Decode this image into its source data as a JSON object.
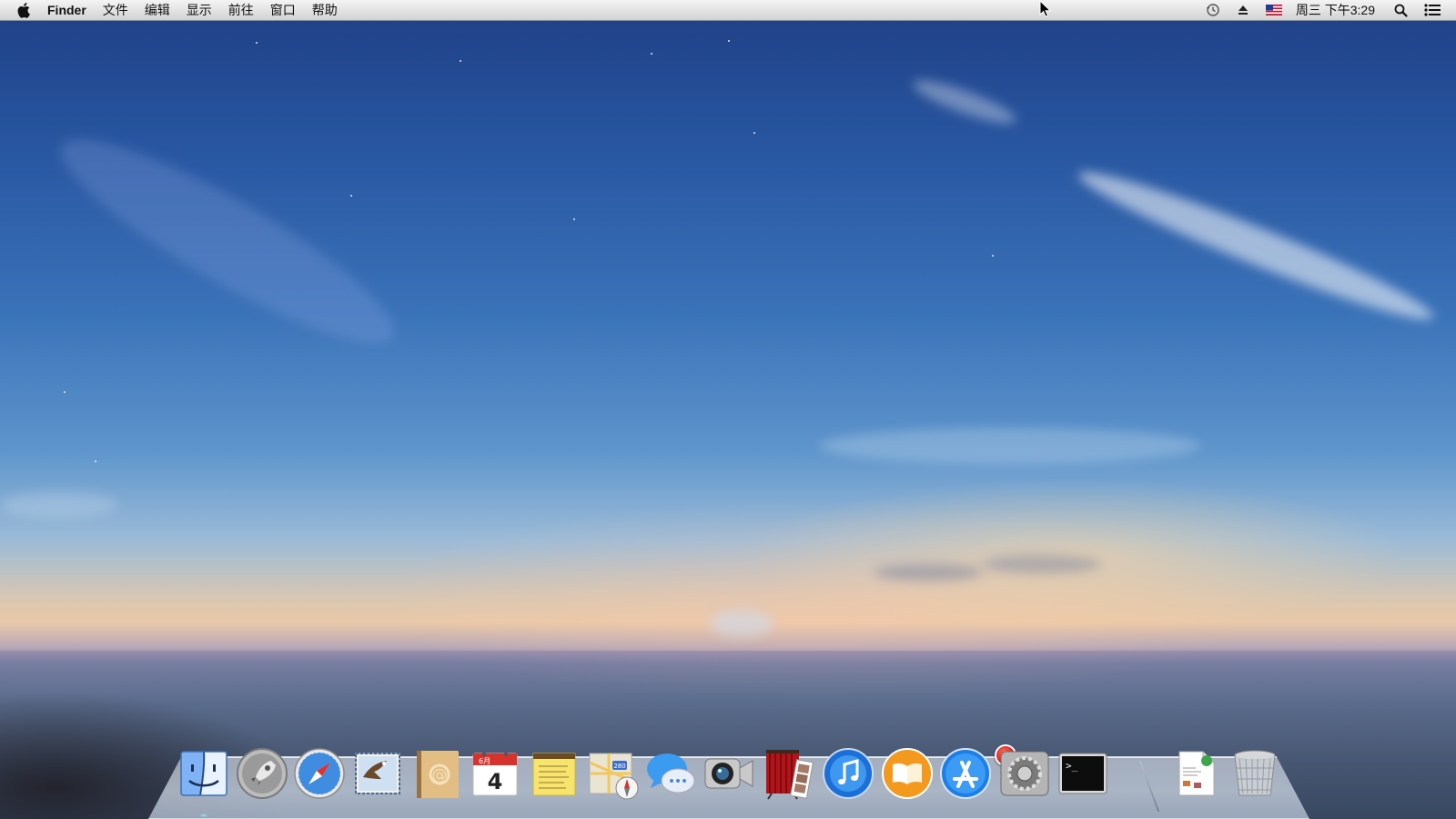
{
  "menubar": {
    "app_name": "Finder",
    "menus": [
      "文件",
      "编辑",
      "显示",
      "前往",
      "窗口",
      "帮助"
    ],
    "status_icons": [
      "time-machine-icon",
      "eject-icon",
      "us-flag-input-icon"
    ],
    "clock": "周三 下午3:29",
    "right_icons": [
      "spotlight-icon",
      "notification-center-icon"
    ]
  },
  "dock": {
    "apps": [
      {
        "name": "Finder",
        "icon": "finder-icon",
        "running": true
      },
      {
        "name": "Launchpad",
        "icon": "launchpad-icon",
        "running": false
      },
      {
        "name": "Safari",
        "icon": "safari-icon",
        "running": false
      },
      {
        "name": "Mail",
        "icon": "mail-icon",
        "running": false
      },
      {
        "name": "Contacts",
        "icon": "contacts-icon",
        "running": false
      },
      {
        "name": "Calendar",
        "icon": "calendar-icon",
        "running": false,
        "date_number": "4",
        "month": "6月"
      },
      {
        "name": "Notes",
        "icon": "notes-icon",
        "running": false
      },
      {
        "name": "Maps",
        "icon": "maps-icon",
        "running": false,
        "label": "280"
      },
      {
        "name": "Messages",
        "icon": "messages-icon",
        "running": false
      },
      {
        "name": "FaceTime",
        "icon": "facetime-icon",
        "running": false
      },
      {
        "name": "Photo Booth",
        "icon": "photo-booth-icon",
        "running": false
      },
      {
        "name": "iTunes",
        "icon": "itunes-icon",
        "running": false
      },
      {
        "name": "iBooks",
        "icon": "ibooks-icon",
        "running": false
      },
      {
        "name": "App Store",
        "icon": "app-store-icon",
        "running": false,
        "badge": "1"
      },
      {
        "name": "System Preferences",
        "icon": "system-preferences-icon",
        "running": false
      },
      {
        "name": "Terminal",
        "icon": "terminal-icon",
        "running": false,
        "prompt": ">_"
      }
    ],
    "stacks": [
      {
        "name": "Document",
        "icon": "document-icon"
      },
      {
        "name": "Trash",
        "icon": "trash-icon"
      }
    ]
  },
  "colors": {
    "sky_top": "#1f3f85",
    "horizon": "#e9c9a8",
    "menubar": "#e2e2e2",
    "badge": "#d2160f"
  }
}
